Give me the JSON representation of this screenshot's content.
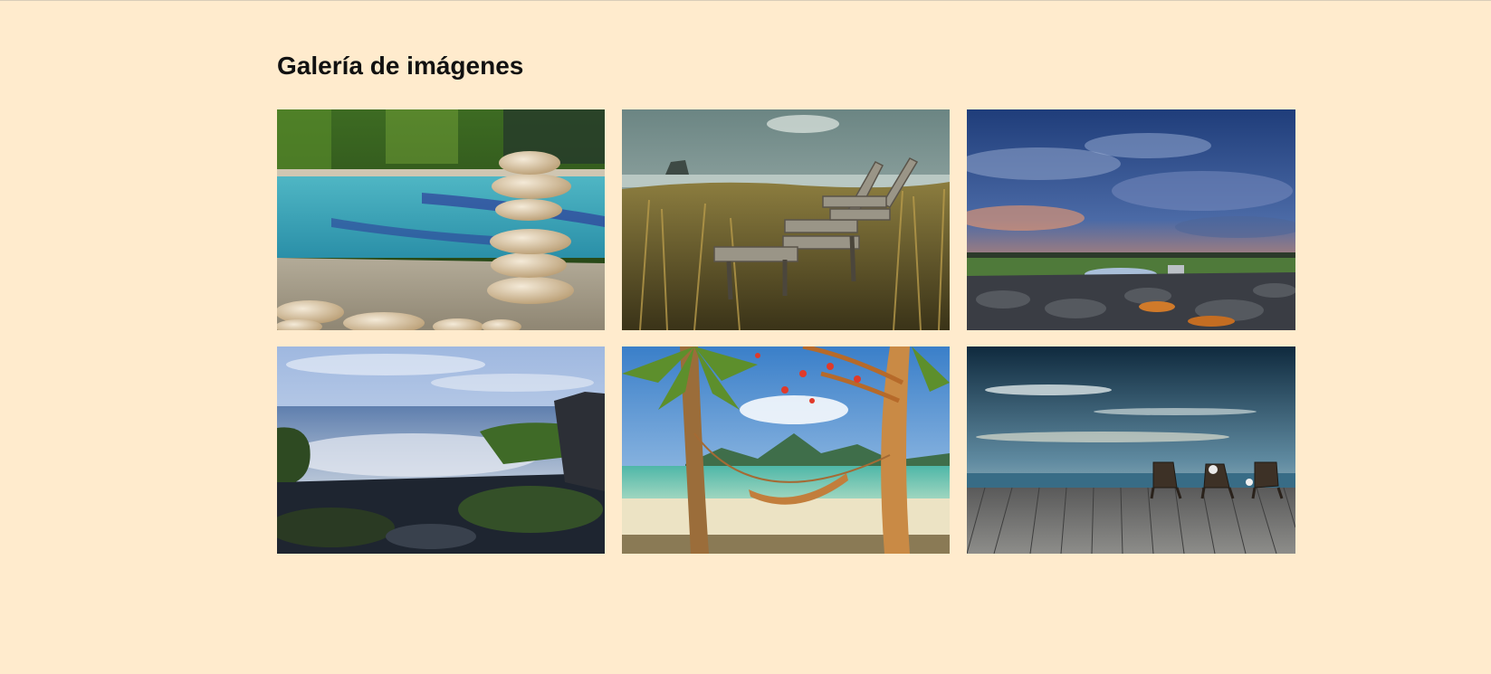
{
  "page": {
    "title": "Galería de imágenes"
  },
  "gallery": {
    "images": [
      {
        "subject": "stacked-stones-by-pool"
      },
      {
        "subject": "wooden-bench-in-dune-grass"
      },
      {
        "subject": "sunset-sky-over-rocky-shore"
      },
      {
        "subject": "misty-sea-with-mossy-rocks"
      },
      {
        "subject": "hammock-between-palm-trees-on-beach"
      },
      {
        "subject": "deck-chairs-on-wooden-pier-by-ocean"
      }
    ]
  }
}
